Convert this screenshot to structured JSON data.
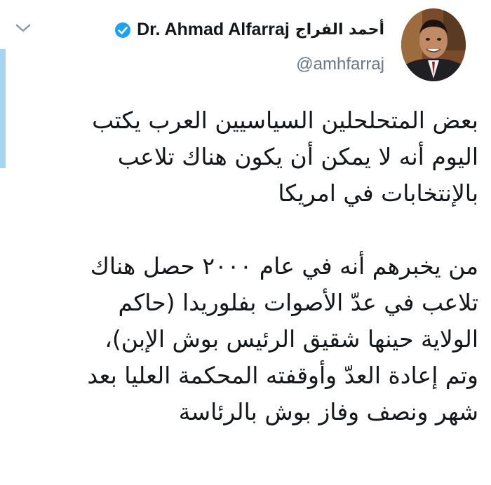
{
  "colors": {
    "accent": "#1da1f2",
    "text": "#14171a",
    "secondary": "#657786",
    "thread_line": "#a9d3f2"
  },
  "header": {
    "arabic_name": "أحمد الفراج",
    "display_name": "Dr. Ahmad Alfarraj",
    "handle": "@amhfarraj",
    "verified_icon": "verified-badge-icon",
    "menu_icon": "chevron-down-icon"
  },
  "tweet": {
    "paragraph_1": "بعض المتحلحلين السياسيين العرب يكتب\nاليوم أنه لا يمكن أن يكون هناك تلاعب\nبالإنتخابات في امريكا",
    "paragraph_2": "من يخبرهم أنه في عام ٢٠٠٠ حصل هناك\nتلاعب في عدّ الأصوات بفلوريدا (حاكم\nالولاية حينها شقيق الرئيس بوش الإبن)،\nوتم إعادة العدّ وأوقفته المحكمة العليا بعد\nشهر ونصف وفاز بوش بالرئاسة"
  }
}
